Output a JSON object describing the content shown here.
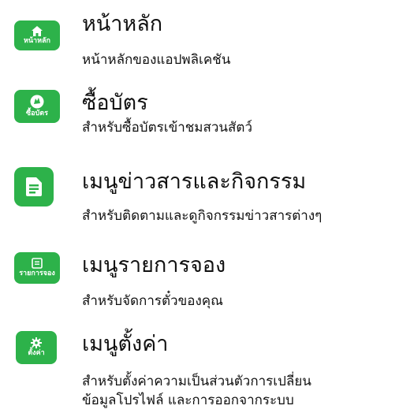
{
  "menu": {
    "items": [
      {
        "icon": "home-icon",
        "icon_caption": "หน้าหลัก",
        "title": "หน้าหลัก",
        "description": [
          "หน้าหลักของแอปพลิเคชัน"
        ]
      },
      {
        "icon": "ticket-icon",
        "icon_caption": "ซื้อบัตร",
        "title": "ซื้อบัตร",
        "description": [
          "สำหรับซื้อบัตรเข้าชมสวนสัตว์"
        ]
      },
      {
        "icon": "news-icon",
        "icon_caption": "",
        "title": "เมนูข่าวสารและกิจกรรม",
        "description": [
          "สำหรับติดตามและดูกิจกรรมข่าวสารต่างๆ"
        ]
      },
      {
        "icon": "booking-list-icon",
        "icon_caption": "รายการจอง",
        "title": "เมนูรายการจอง",
        "description": [
          "สำหรับจัดการตั๋วของคุณ"
        ]
      },
      {
        "icon": "settings-icon",
        "icon_caption": "ตั้งค่า",
        "title": "เมนูตั้งค่า",
        "description": [
          "สำหรับตั้งค่าความเป็นส่วนตัวการเปลี่ยน",
          "ข้อมูลโปรไฟล์ และการออกจากระบบ"
        ]
      }
    ],
    "accent_color": "#2db24a"
  }
}
